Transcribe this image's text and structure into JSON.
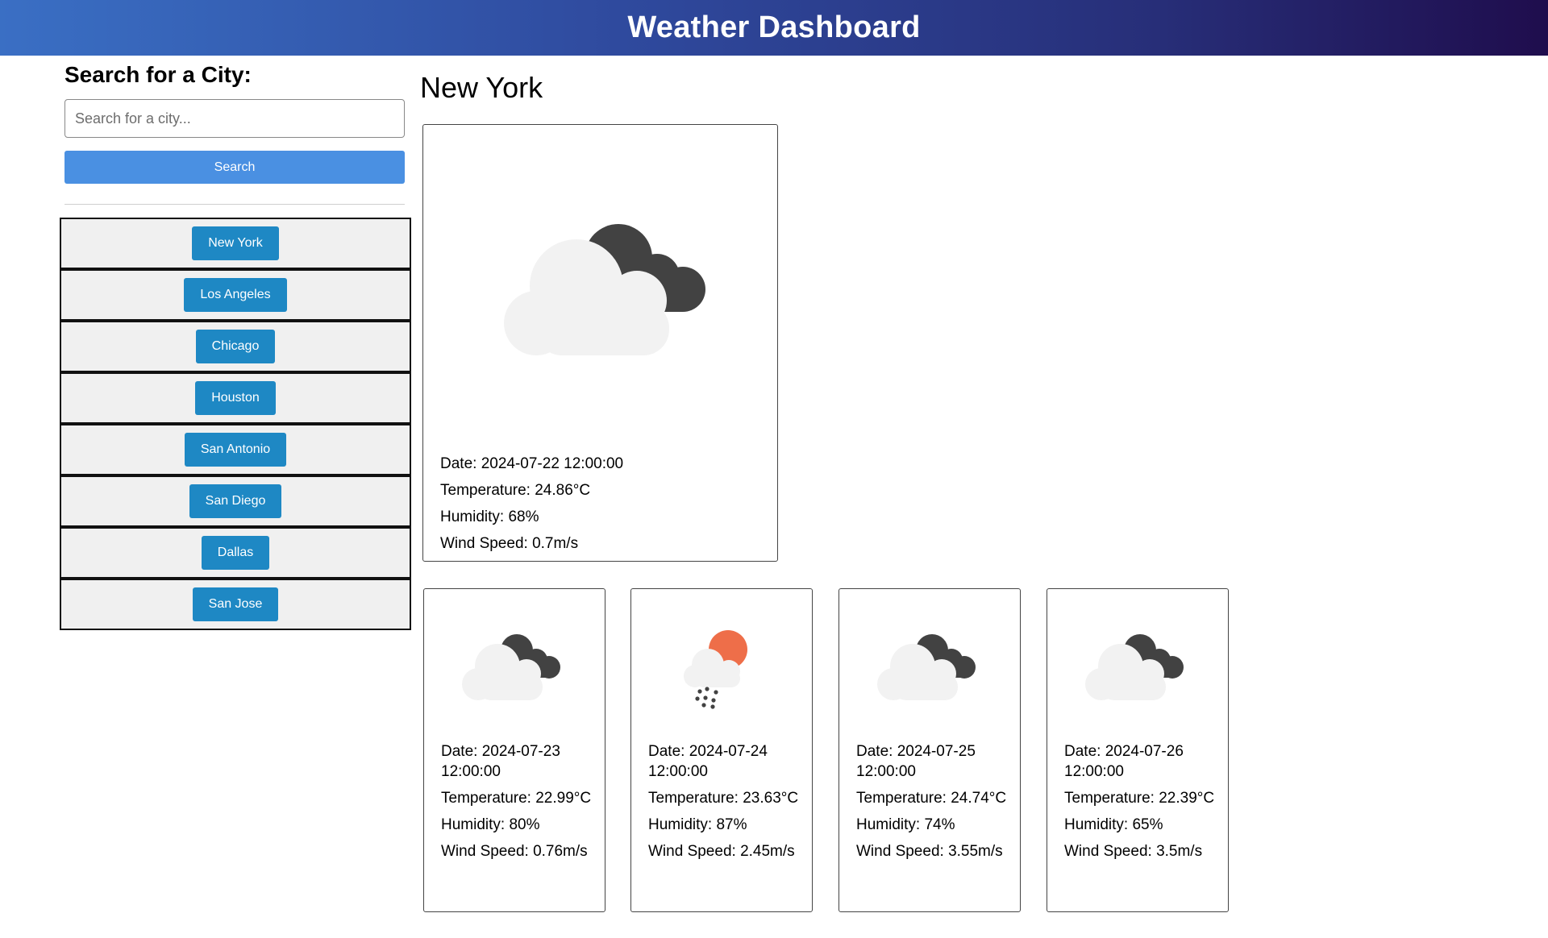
{
  "header": {
    "title": "Weather Dashboard"
  },
  "sidebar": {
    "heading": "Search for a City:",
    "search_placeholder": "Search for a city...",
    "search_button": "Search",
    "cities": [
      "New York",
      "Los Angeles",
      "Chicago",
      "Houston",
      "San Antonio",
      "San Diego",
      "Dallas",
      "San Jose"
    ]
  },
  "main": {
    "city": "New York",
    "current": {
      "icon": "broken-clouds-icon",
      "date": "Date: 2024-07-22 12:00:00",
      "temperature": "Temperature: 24.86°C",
      "humidity": "Humidity: 68%",
      "wind": "Wind Speed: 0.7m/s"
    },
    "forecast": [
      {
        "icon": "broken-clouds-icon",
        "date": "Date: 2024-07-23 12:00:00",
        "temperature": "Temperature: 22.99°C",
        "humidity": "Humidity: 80%",
        "wind": "Wind Speed: 0.76m/s"
      },
      {
        "icon": "rain-sun-icon",
        "date": "Date: 2024-07-24 12:00:00",
        "temperature": "Temperature: 23.63°C",
        "humidity": "Humidity: 87%",
        "wind": "Wind Speed: 2.45m/s"
      },
      {
        "icon": "broken-clouds-icon",
        "date": "Date: 2024-07-25 12:00:00",
        "temperature": "Temperature: 24.74°C",
        "humidity": "Humidity: 74%",
        "wind": "Wind Speed: 3.55m/s"
      },
      {
        "icon": "broken-clouds-icon",
        "date": "Date: 2024-07-26 12:00:00",
        "temperature": "Temperature: 22.39°C",
        "humidity": "Humidity: 65%",
        "wind": "Wind Speed: 3.5m/s"
      }
    ]
  },
  "colors": {
    "header_gradient_start": "#3a6fc4",
    "header_gradient_end": "#1f0d4d",
    "search_button": "#4a90e2",
    "city_button": "#1e88c4",
    "city_row_bg": "#f0f0f0",
    "dark_cloud": "#424242",
    "light_cloud": "#f2f2f2",
    "sun": "#ee6e49"
  }
}
